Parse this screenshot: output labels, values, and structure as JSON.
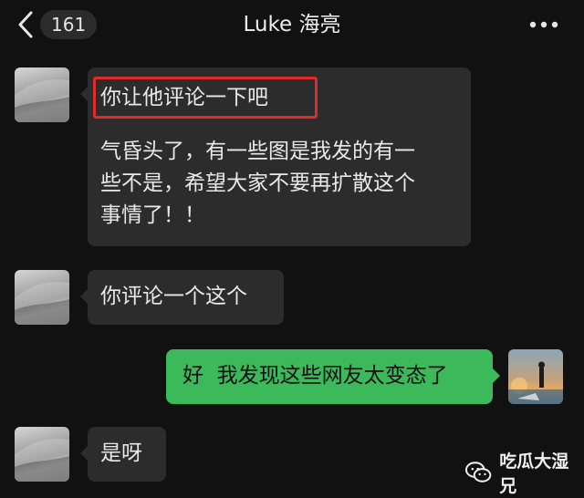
{
  "header": {
    "back_icon": "chevron-left-icon",
    "unread_count": "161",
    "title": "Luke 海亮",
    "more_icon": "more-dots-icon"
  },
  "messages": [
    {
      "side": "left",
      "lines": [
        "你让他评论一下吧",
        "",
        "气昏头了，有一些图是我发的有一",
        "些不是，希望大家不要再扩散这个",
        "事情了！！"
      ],
      "highlighted_line": "你让他评论一下吧"
    },
    {
      "side": "left",
      "lines": [
        "你评论一个这个"
      ]
    },
    {
      "side": "right",
      "lines": [
        "好  我发现这些网友太变态了"
      ]
    },
    {
      "side": "left",
      "lines": [
        "是呀"
      ]
    }
  ],
  "watermark": {
    "icon": "wechat-icon",
    "text": "吃瓜大湿兄"
  },
  "colors": {
    "background": "#111111",
    "bubble_left": "#2c2c2c",
    "bubble_right": "#3cb95b",
    "highlight": "#e22a2a"
  }
}
